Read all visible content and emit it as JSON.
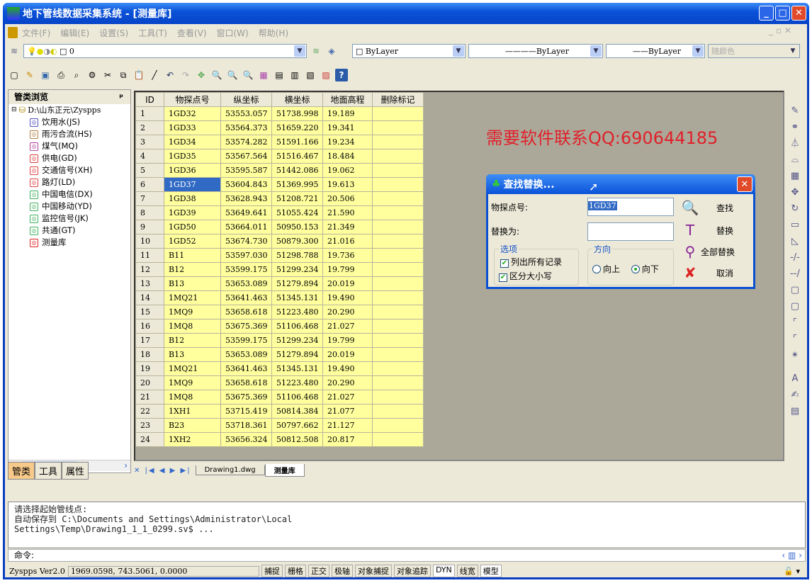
{
  "window": {
    "title": "地下管线数据采集系统 - [测量库]",
    "controls": [
      "_",
      "□",
      "✕"
    ]
  },
  "menu": [
    "文件(F)",
    "编辑(E)",
    "设置(S)",
    "工具(T)",
    "查看(V)",
    "窗口(W)",
    "帮助(H)"
  ],
  "mdi_controls": "_ ▫ ✕",
  "toolbar1": {
    "layer": "0",
    "color": "ByLayer",
    "linetype": "ByLayer",
    "lineweight": "ByLayer",
    "plotstyle": "随颜色"
  },
  "left_panel": {
    "title": "管类浏览",
    "pin": "ᵖ",
    "root": "D:\\山东正元\\Zyspps",
    "items": [
      {
        "label": "饮用水(JS)",
        "color": "#5050c0"
      },
      {
        "label": "雨污合流(HS)",
        "color": "#b08040"
      },
      {
        "label": "煤气(MQ)",
        "color": "#b040a0"
      },
      {
        "label": "供电(GD)",
        "color": "#e04040"
      },
      {
        "label": "交通信号(XH)",
        "color": "#e04040"
      },
      {
        "label": "路灯(LD)",
        "color": "#e04040"
      },
      {
        "label": "中国电信(DX)",
        "color": "#40b060"
      },
      {
        "label": "中国移动(YD)",
        "color": "#40b060"
      },
      {
        "label": "监控信号(JK)",
        "color": "#40b060"
      },
      {
        "label": "共通(GT)",
        "color": "#40b060"
      },
      {
        "label": "测量库",
        "color": "#e02020"
      }
    ],
    "tabs": [
      "管类",
      "工具",
      "属性"
    ]
  },
  "table": {
    "headers": [
      "ID",
      "物探点号",
      "纵坐标",
      "横坐标",
      "地面高程",
      "删除标记"
    ],
    "selected_row": 6,
    "rows": [
      [
        "1",
        "1GD32",
        "53553.057",
        "51738.998",
        "19.189",
        ""
      ],
      [
        "2",
        "1GD33",
        "53564.373",
        "51659.220",
        "19.341",
        ""
      ],
      [
        "3",
        "1GD34",
        "53574.282",
        "51591.166",
        "19.234",
        ""
      ],
      [
        "4",
        "1GD35",
        "53567.564",
        "51516.467",
        "18.484",
        ""
      ],
      [
        "5",
        "1GD36",
        "53595.587",
        "51442.086",
        "19.062",
        ""
      ],
      [
        "6",
        "1GD37",
        "53604.843",
        "51369.995",
        "19.613",
        ""
      ],
      [
        "7",
        "1GD38",
        "53628.943",
        "51208.721",
        "20.506",
        ""
      ],
      [
        "8",
        "1GD39",
        "53649.641",
        "51055.424",
        "21.590",
        ""
      ],
      [
        "9",
        "1GD50",
        "53664.011",
        "50950.153",
        "21.349",
        ""
      ],
      [
        "10",
        "1GD52",
        "53674.730",
        "50879.300",
        "21.016",
        ""
      ],
      [
        "11",
        "B11",
        "53597.030",
        "51298.788",
        "19.736",
        ""
      ],
      [
        "12",
        "B12",
        "53599.175",
        "51299.234",
        "19.799",
        ""
      ],
      [
        "13",
        "B13",
        "53653.089",
        "51279.894",
        "20.019",
        ""
      ],
      [
        "14",
        "1MQ21",
        "53641.463",
        "51345.131",
        "19.490",
        ""
      ],
      [
        "15",
        "1MQ9",
        "53658.618",
        "51223.480",
        "20.290",
        ""
      ],
      [
        "16",
        "1MQ8",
        "53675.369",
        "51106.468",
        "21.027",
        ""
      ],
      [
        "17",
        "B12",
        "53599.175",
        "51299.234",
        "19.799",
        ""
      ],
      [
        "18",
        "B13",
        "53653.089",
        "51279.894",
        "20.019",
        ""
      ],
      [
        "19",
        "1MQ21",
        "53641.463",
        "51345.131",
        "19.490",
        ""
      ],
      [
        "20",
        "1MQ9",
        "53658.618",
        "51223.480",
        "20.290",
        ""
      ],
      [
        "21",
        "1MQ8",
        "53675.369",
        "51106.468",
        "21.027",
        ""
      ],
      [
        "22",
        "1XH1",
        "53715.419",
        "50814.384",
        "21.077",
        ""
      ],
      [
        "23",
        "B23",
        "53718.361",
        "50797.662",
        "21.127",
        ""
      ],
      [
        "24",
        "1XH2",
        "53656.324",
        "50812.508",
        "20.817",
        ""
      ]
    ]
  },
  "watermark": "需要软件联系QQ:690644185",
  "dialog": {
    "title": "查找替换...",
    "find_label": "物探点号:",
    "find_value": "1GD37",
    "replace_label": "替换为:",
    "replace_value": "",
    "options_title": "选项",
    "opt_list_all": "列出所有记录",
    "opt_case": "区分大小写",
    "direction_title": "方向",
    "dir_up": "向上",
    "dir_down": "向下",
    "btn_find": "查找",
    "btn_replace": "替换",
    "btn_replace_all": "全部替换",
    "btn_cancel": "取消"
  },
  "doc_tabs": {
    "nav": "✕ |◀ ◀ ▶ ▶|",
    "tabs": [
      "Drawing1.dwg",
      "测量库"
    ]
  },
  "command": {
    "history": [
      "请选择起始管线点:",
      "自动保存到 C:\\Documents and Settings\\Administrator\\Local",
      "Settings\\Temp\\Drawing1_1_1_0299.sv$ ..."
    ],
    "prompt": "命令:"
  },
  "status": {
    "version": "Zyspps Ver2.0",
    "coords": "1969.0598, 743.5061, 0.0000",
    "toggles": [
      "捕捉",
      "栅格",
      "正交",
      "极轴",
      "对象捕捉",
      "对象追踪",
      "DYN",
      "线宽",
      "模型"
    ]
  }
}
